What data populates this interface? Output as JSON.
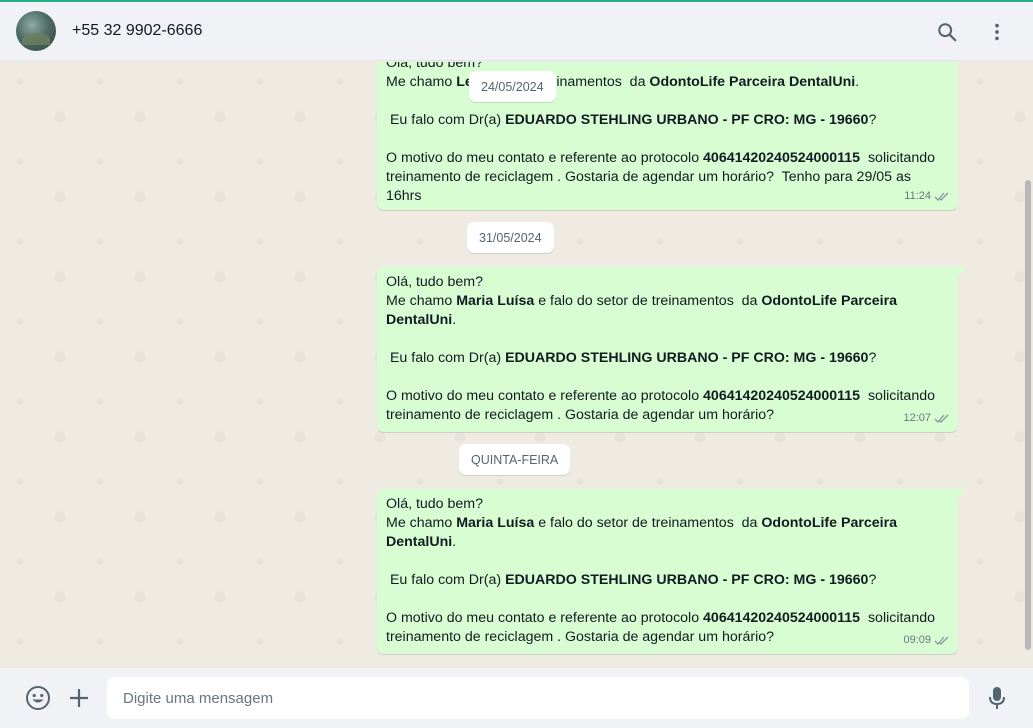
{
  "header": {
    "contact_name": "+55 32 9902-6666",
    "icons": [
      "search-icon",
      "menu-icon"
    ]
  },
  "messages": [
    {
      "date_chip": "24/05/2024",
      "line1": "Olá, tudo bem?",
      "line2_pre": "Me chamo ",
      "line2_name": "Le",
      "line2_hidden_mid": "o",
      "line2_post": " setor de treinamentos  da ",
      "line2_company": "OdontoLife Parceira DentalUni",
      "line2_end": ".",
      "dr_pre": " Eu falo com Dr(a) ",
      "dr_name": "EDUARDO STEHLING URBANO - PF CRO: MG - 19660",
      "dr_end": "?",
      "proto_pre": "O motivo do meu contato e referente ao protocolo ",
      "proto_num": "40641420240524000115",
      "proto_post": "  solicitando treinamento de reciclagem . Gostaria de agendar um horário?  Tenho para 29/05 as 16hrs",
      "time": "11:24"
    },
    {
      "date_chip": "31/05/2024",
      "line1": "Olá, tudo bem?",
      "line2_pre": "Me chamo ",
      "line2_name": "Maria Luísa",
      "line2_post": " e falo do setor de treinamentos  da ",
      "line2_company": "OdontoLife Parceira DentalUni",
      "line2_end": ".",
      "dr_pre": " Eu falo com Dr(a) ",
      "dr_name": "EDUARDO STEHLING URBANO - PF CRO: MG - 19660",
      "dr_end": "?",
      "proto_pre": "O motivo do meu contato e referente ao protocolo ",
      "proto_num": "40641420240524000115",
      "proto_post": "  solicitando treinamento de reciclagem . Gostaria de agendar um horário?",
      "time": "12:07"
    },
    {
      "date_chip": "QUINTA-FEIRA",
      "line1": "Olá, tudo bem?",
      "line2_pre": "Me chamo ",
      "line2_name": "Maria Luísa",
      "line2_post": " e falo do setor de treinamentos  da ",
      "line2_company": "OdontoLife Parceira DentalUni",
      "line2_end": ".",
      "dr_pre": " Eu falo com Dr(a) ",
      "dr_name": "EDUARDO STEHLING URBANO - PF CRO: MG - 19660",
      "dr_end": "?",
      "proto_pre": "O motivo do meu contato e referente ao protocolo ",
      "proto_num": "40641420240524000115",
      "proto_post": "  solicitando treinamento de reciclagem . Gostaria de agendar um horário?",
      "time": "09:09"
    }
  ],
  "composer": {
    "placeholder": "Digite uma mensagem",
    "icons": [
      "emoji-icon",
      "attach-plus-icon",
      "microphone-icon"
    ]
  },
  "colors": {
    "accent": "#25b08a",
    "outgoing_bubble": "#d9fdd3",
    "chat_background": "#efeae2",
    "header_background": "#f0f2f5"
  }
}
